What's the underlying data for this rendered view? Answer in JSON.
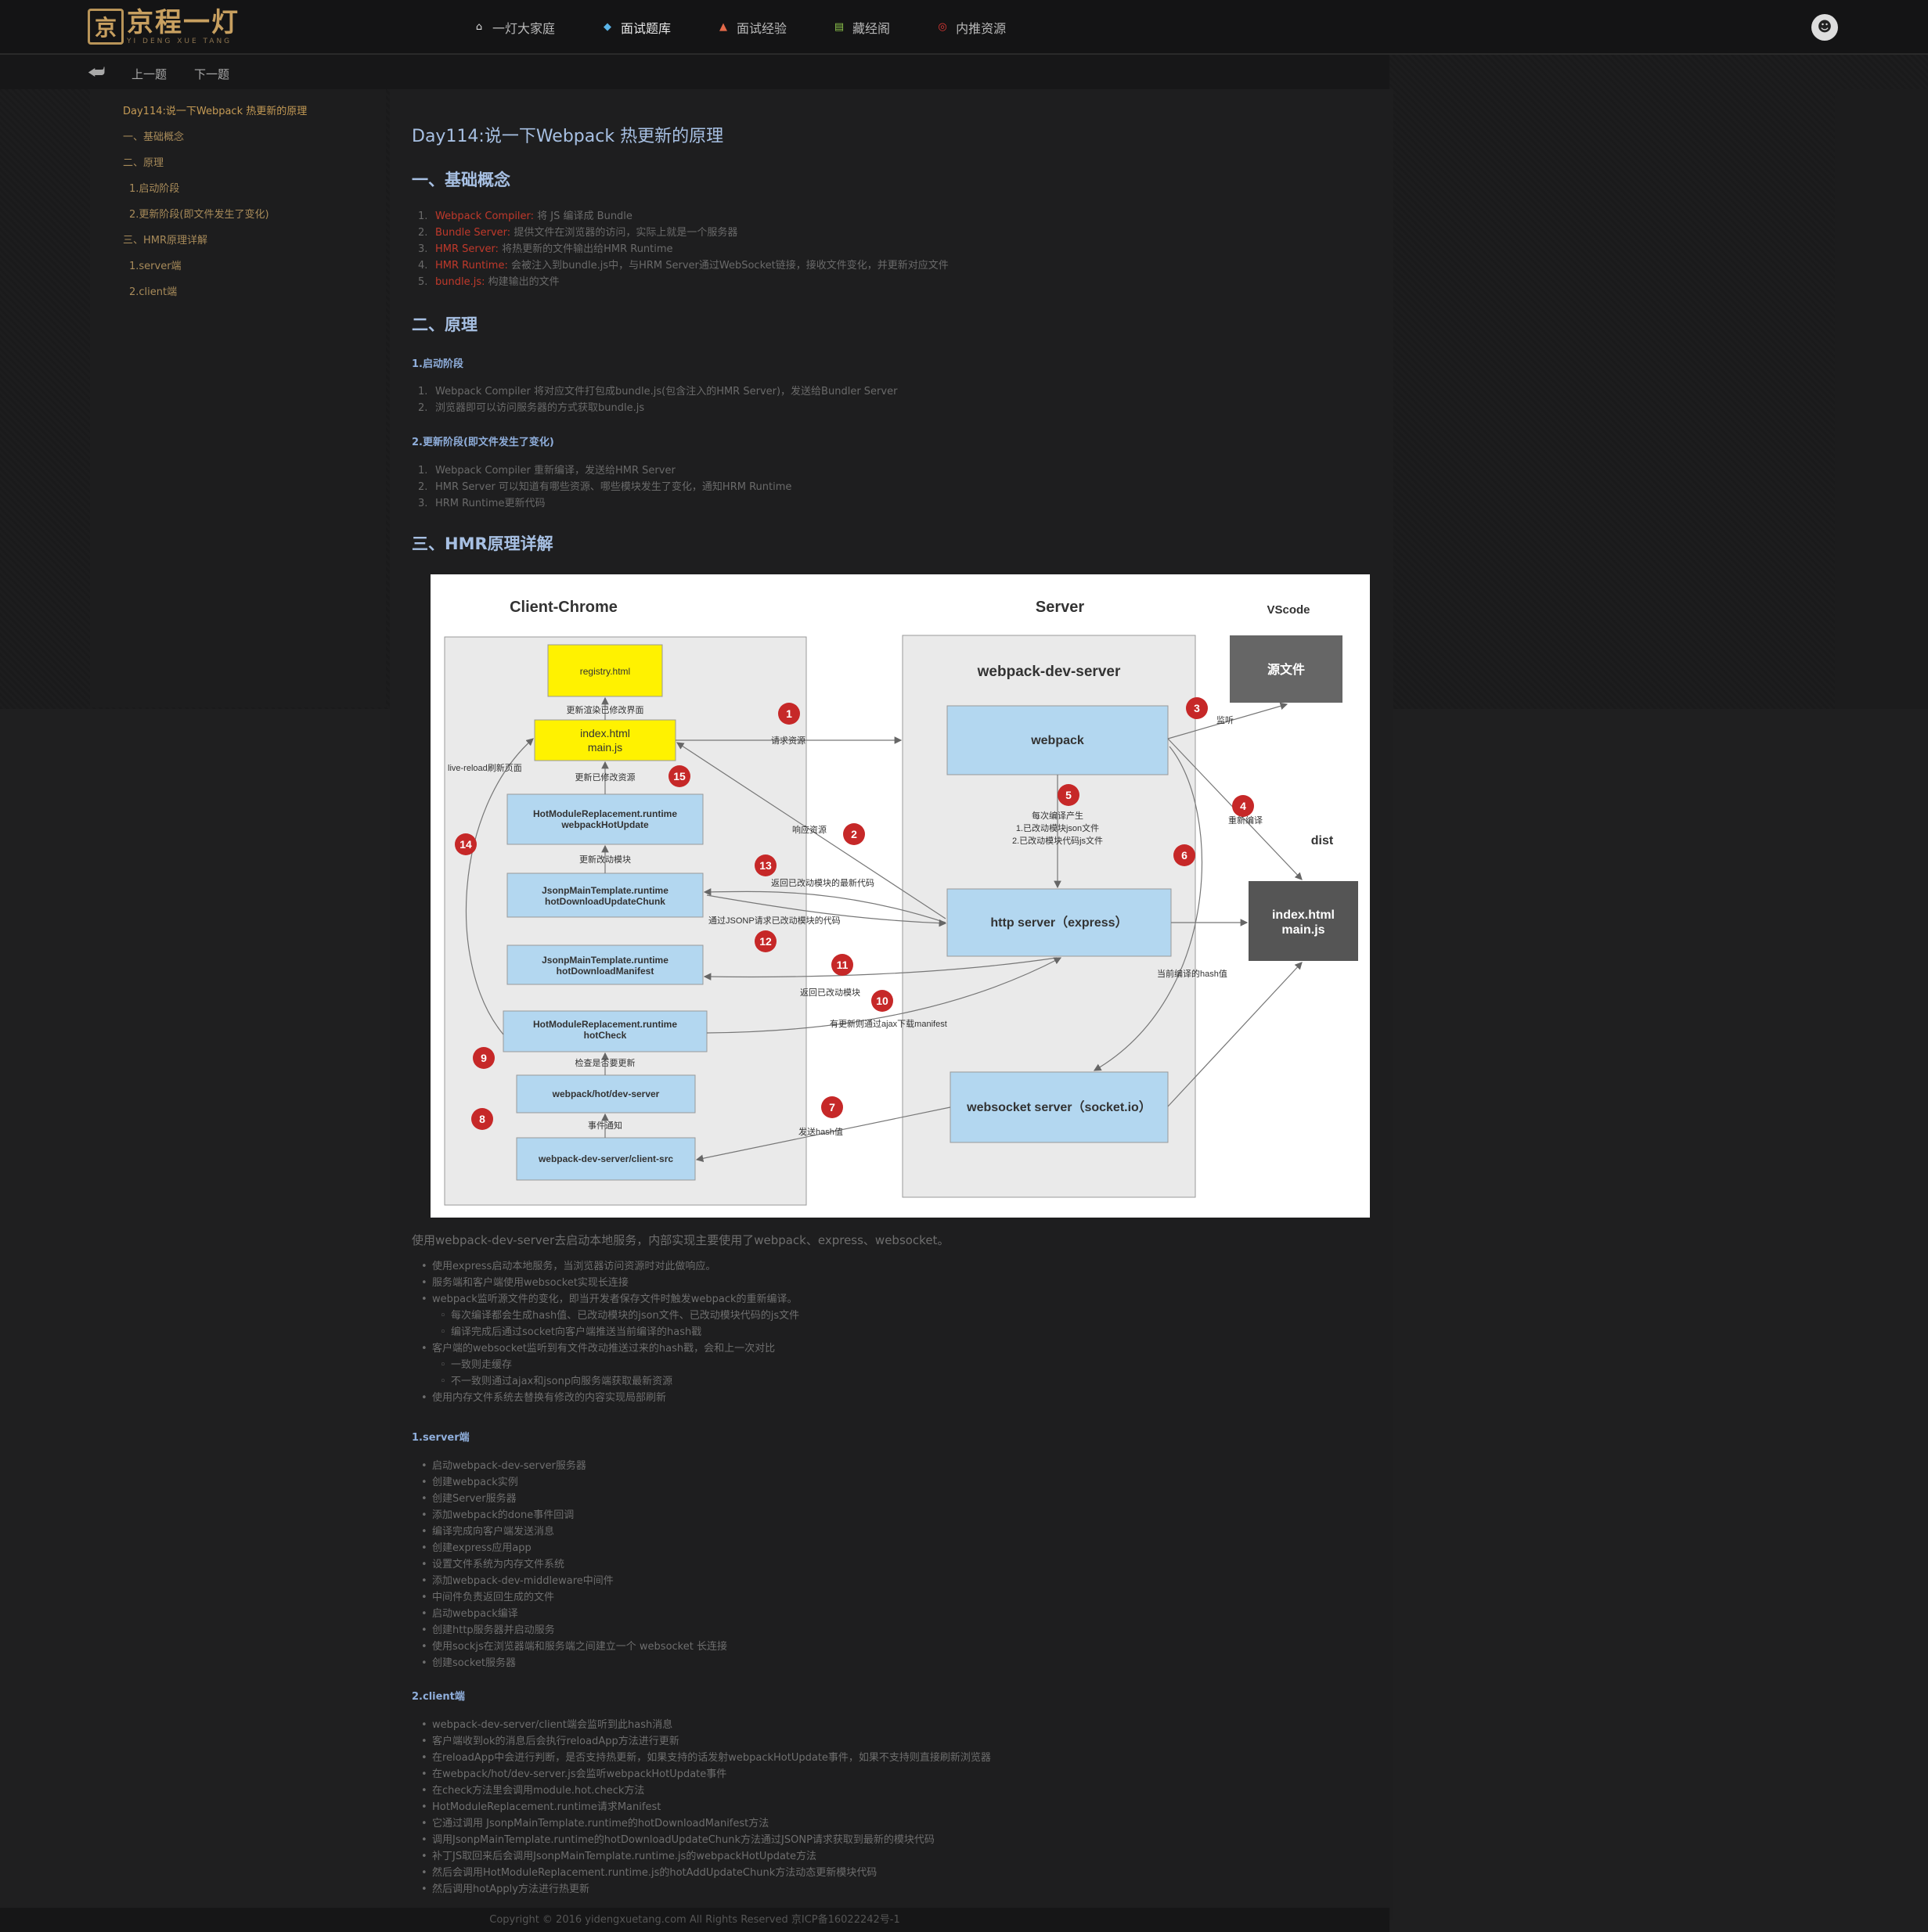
{
  "site": {
    "logo_cn": "京程一灯",
    "logo_en": "YI DENG XUE TANG"
  },
  "nav": [
    {
      "label": "一灯大家庭",
      "icon": "home-icon"
    },
    {
      "label": "面试题库",
      "icon": "diamond-icon"
    },
    {
      "label": "面试经验",
      "icon": "shoe-icon"
    },
    {
      "label": "藏经阁",
      "icon": "book-icon"
    },
    {
      "label": "内推资源",
      "icon": "target-icon"
    }
  ],
  "subnav": {
    "prev": "上一题",
    "next": "下一题"
  },
  "toc": [
    "Day114:说一下Webpack 热更新的原理",
    "一、基础概念",
    "二、原理",
    "1.启动阶段",
    "2.更新阶段(即文件发生了变化)",
    "三、HMR原理详解",
    "1.server端",
    "2.client端"
  ],
  "article": {
    "title": "Day114:说一下Webpack 热更新的原理",
    "h_basic": "一、基础概念",
    "basic": [
      {
        "term": "Webpack Compiler:",
        "text": " 将 JS 编译成 Bundle"
      },
      {
        "term": "Bundle Server:",
        "text": " 提供文件在浏览器的访问，实际上就是一个服务器"
      },
      {
        "term": "HMR Server:",
        "text": " 将热更新的文件输出给HMR Runtime"
      },
      {
        "term": "HMR Runtime:",
        "text": " 会被注入到bundle.js中，与HRM Server通过WebSocket链接，接收文件变化，并更新对应文件"
      },
      {
        "term": "bundle.js:",
        "text": " 构建输出的文件"
      }
    ],
    "h_principle": "二、原理",
    "h_start": "1.启动阶段",
    "start": [
      "Webpack Compiler 将对应文件打包成bundle.js(包含注入的HMR Server)，发送给Bundler Server",
      "浏览器即可以访问服务器的方式获取bundle.js"
    ],
    "h_update": "2.更新阶段(即文件发生了变化)",
    "update": [
      "Webpack Compiler 重新编译，发送给HMR Server",
      "HMR Server 可以知道有哪些资源、哪些模块发生了变化，通知HRM Runtime",
      "HRM Runtime更新代码"
    ],
    "h_hmr": "三、HMR原理详解",
    "intro": "使用webpack-dev-server去启动本地服务，内部实现主要使用了webpack、express、websocket。",
    "hmr_list": [
      {
        "t": "使用express启动本地服务，当浏览器访问资源时对此做响应。",
        "s": false
      },
      {
        "t": "服务端和客户端使用websocket实现长连接",
        "s": false
      },
      {
        "t": "webpack监听源文件的变化，即当开发者保存文件时触发webpack的重新编译。",
        "s": false
      },
      {
        "t": "每次编译都会生成hash值、已改动模块的json文件、已改动模块代码的js文件",
        "s": true
      },
      {
        "t": "编译完成后通过socket向客户端推送当前编译的hash戳",
        "s": true
      },
      {
        "t": "客户端的websocket监听到有文件改动推送过来的hash戳，会和上一次对比",
        "s": false
      },
      {
        "t": "一致则走缓存",
        "s": true
      },
      {
        "t": "不一致则通过ajax和jsonp向服务端获取最新资源",
        "s": true
      },
      {
        "t": "使用内存文件系统去替换有修改的内容实现局部刷新",
        "s": false
      }
    ],
    "h_server": "1.server端",
    "server_list": [
      "启动webpack-dev-server服务器",
      "创建webpack实例",
      "创建Server服务器",
      "添加webpack的done事件回调",
      "编译完成向客户端发送消息",
      "创建express应用app",
      "设置文件系统为内存文件系统",
      "添加webpack-dev-middleware中间件",
      "中间件负责返回生成的文件",
      "启动webpack编译",
      "创建http服务器并启动服务",
      "使用sockjs在浏览器端和服务端之间建立一个 websocket 长连接",
      "创建socket服务器"
    ],
    "h_client": "2.client端",
    "client_list": [
      "webpack-dev-server/client端会监听到此hash消息",
      "客户端收到ok的消息后会执行reloadApp方法进行更新",
      "在reloadApp中会进行判断，是否支持热更新，如果支持的话发射webpackHotUpdate事件，如果不支持则直接刷新浏览器",
      "在webpack/hot/dev-server.js会监听webpackHotUpdate事件",
      "在check方法里会调用module.hot.check方法",
      "HotModuleReplacement.runtime请求Manifest",
      "它通过调用 JsonpMainTemplate.runtime的hotDownloadManifest方法",
      "调用JsonpMainTemplate.runtime的hotDownloadUpdateChunk方法通过JSONP请求获取到最新的模块代码",
      "补丁JS取回来后会调用JsonpMainTemplate.runtime.js的webpackHotUpdate方法",
      "然后会调用HotModuleReplacement.runtime.js的hotAddUpdateChunk方法动态更新模块代码",
      "然后调用hotApply方法进行热更新"
    ]
  },
  "diagram": {
    "col_client": "Client-Chrome",
    "col_server": "Server",
    "col_vscode": "VScode",
    "boxes": {
      "registry": "registry.html",
      "index1": "index.html",
      "index2": "main.js",
      "hmr_hot1": "HotModuleReplacement.runtime",
      "hmr_hot2": "webpackHotUpdate",
      "jsonp_chunk1": "JsonpMainTemplate.runtime",
      "jsonp_chunk2": "hotDownloadUpdateChunk",
      "jsonp_man1": "JsonpMainTemplate.runtime",
      "jsonp_man2": "hotDownloadManifest",
      "hmr_check1": "HotModuleReplacement.runtime",
      "hmr_check2": "hotCheck",
      "hot_dev": "webpack/hot/dev-server",
      "client_src": "webpack-dev-server/client-src",
      "wds": "webpack-dev-server",
      "webpack": "webpack",
      "http": "http server（express）",
      "ws": "websocket server（socket.io）",
      "src": "源文件",
      "dist": "dist",
      "dist1": "index.html",
      "dist2": "main.js"
    },
    "labels": {
      "render": "更新渲染已修改界面",
      "update_res": "更新已修改资源",
      "update_mod": "更新改动模块",
      "check_update": "检查是否要更新",
      "event": "事件通知",
      "live": "live-reload刷新页面",
      "req": "请求资源",
      "resp": "响应资源",
      "watch": "监听",
      "recompile": "重新编译",
      "compile1": "每次编译产生",
      "compile2": "1.已改动模块json文件",
      "compile3": "2.已改动模块代码js文件",
      "return_code": "返回已改动模块的最新代码",
      "jsonp_req": "通过JSONP请求已改动模块的代码",
      "return_mod": "返回已改动模块",
      "ajax": "有更新则通过ajax下载manifest",
      "hash_cur": "当前编译的hash值",
      "send_hash": "发送hash值"
    }
  },
  "footer": "Copyright © 2016 yidengxuetang.com All Rights Reserved 京ICP备16022242号-1",
  "colors": {
    "accent": "#c0392b",
    "box_blue": "#b3d7f0",
    "box_yellow": "#fff200",
    "heading": "#a7c0e3"
  }
}
